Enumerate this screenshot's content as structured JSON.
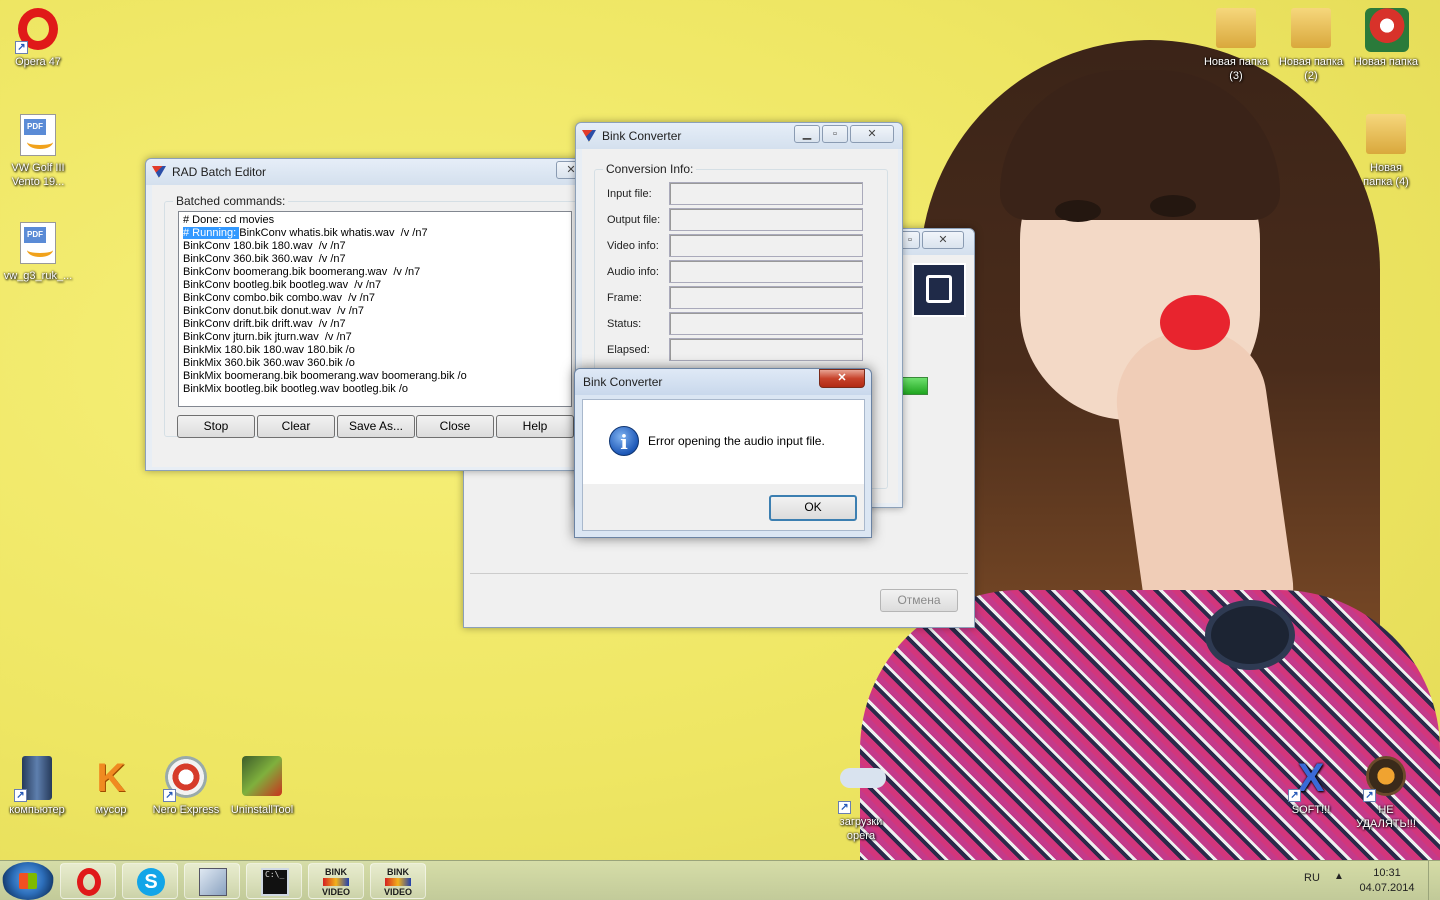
{
  "desktop": {
    "left_icons": [
      {
        "label": "Opera 47"
      },
      {
        "label": "VW Golf III Vento 19..."
      },
      {
        "label": "vw_g3_ruk_..."
      }
    ],
    "top_right_icons": [
      {
        "label": "Новая папка (3)"
      },
      {
        "label": "Новая папка (2)"
      },
      {
        "label": "Новая папка"
      },
      {
        "label": "Новая папка (4)"
      }
    ],
    "bottom_icons": [
      {
        "label": "компьютер"
      },
      {
        "label": "мусор"
      },
      {
        "label": "Nero Express"
      },
      {
        "label": "UninstallTool"
      },
      {
        "label": "загрузки opera"
      },
      {
        "label": "SOFT!!!"
      },
      {
        "label": "НЕ УДАЛЯТЬ!!!"
      }
    ]
  },
  "rad_batch_editor": {
    "title": "RAD Batch Editor",
    "group_label": "Batched commands:",
    "commands": [
      {
        "prefix": "",
        "text": "# Done: cd movies"
      },
      {
        "prefix": "# Running: ",
        "text": "BinkConv whatis.bik whatis.wav  /v /n7"
      },
      {
        "prefix": "",
        "text": "BinkConv 180.bik 180.wav  /v /n7"
      },
      {
        "prefix": "",
        "text": "BinkConv 360.bik 360.wav  /v /n7"
      },
      {
        "prefix": "",
        "text": "BinkConv boomerang.bik boomerang.wav  /v /n7"
      },
      {
        "prefix": "",
        "text": "BinkConv bootleg.bik bootleg.wav  /v /n7"
      },
      {
        "prefix": "",
        "text": "BinkConv combo.bik combo.wav  /v /n7"
      },
      {
        "prefix": "",
        "text": "BinkConv donut.bik donut.wav  /v /n7"
      },
      {
        "prefix": "",
        "text": "BinkConv drift.bik drift.wav  /v /n7"
      },
      {
        "prefix": "",
        "text": "BinkConv jturn.bik jturn.wav  /v /n7"
      },
      {
        "prefix": "",
        "text": "BinkMix 180.bik 180.wav 180.bik /o"
      },
      {
        "prefix": "",
        "text": "BinkMix 360.bik 360.wav 360.bik /o"
      },
      {
        "prefix": "",
        "text": "BinkMix boomerang.bik boomerang.wav boomerang.bik /o"
      },
      {
        "prefix": "",
        "text": "BinkMix bootleg.bik bootleg.wav bootleg.bik /o"
      }
    ],
    "buttons": {
      "stop": "Stop",
      "clear": "Clear",
      "save_as": "Save As...",
      "close": "Close",
      "help": "Help"
    }
  },
  "bink_converter": {
    "title": "Bink Converter",
    "group_label": "Conversion Info:",
    "fields": [
      {
        "label": "Input file:"
      },
      {
        "label": "Output file:"
      },
      {
        "label": "Video info:"
      },
      {
        "label": "Audio info:"
      },
      {
        "label": "Frame:"
      },
      {
        "label": "Status:"
      },
      {
        "label": "Elapsed:"
      }
    ]
  },
  "background_window": {
    "cancel_label": "Отмена"
  },
  "error_dialog": {
    "title": "Bink Converter",
    "message": "Error opening the audio input file.",
    "ok_label": "OK"
  },
  "taskbar": {
    "language": "RU",
    "time": "10:31",
    "date": "04.07.2014",
    "apps": [
      "start",
      "opera",
      "skype",
      "network-installer",
      "cmd",
      "bink-video-1",
      "bink-video-2"
    ],
    "bink_label_top": "BINK",
    "bink_label_bottom": "VIDEO"
  }
}
